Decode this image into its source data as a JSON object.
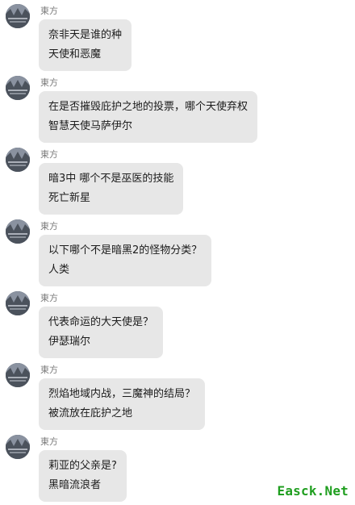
{
  "messages": [
    {
      "sender": "東方",
      "lines": [
        "奈非天是谁的种",
        "天使和恶魔"
      ]
    },
    {
      "sender": "東方",
      "lines": [
        "在是否摧毁庇护之地的投票，哪个天使弃权",
        "智慧天使马萨伊尔"
      ]
    },
    {
      "sender": "東方",
      "lines": [
        "暗3中 哪个不是巫医的技能",
        "死亡新星"
      ]
    },
    {
      "sender": "東方",
      "lines": [
        "以下哪个不是暗黑2的怪物分类？",
        "人类"
      ]
    },
    {
      "sender": "東方",
      "lines": [
        "代表命运的大天使是？",
        "伊瑟瑞尔"
      ]
    },
    {
      "sender": "東方",
      "lines": [
        "烈焰地域内战，三魔神的结局？",
        "被流放在庇护之地"
      ]
    },
    {
      "sender": "東方",
      "lines": [
        "莉亚的父亲是?",
        "黑暗流浪者"
      ]
    }
  ],
  "watermark": "Easck.Net",
  "colors": {
    "bubble": "#e7e7e7",
    "sender": "#7a7a7a",
    "watermark": "#1f9e1f"
  },
  "icons": {
    "avatar": "user-avatar-icon"
  }
}
